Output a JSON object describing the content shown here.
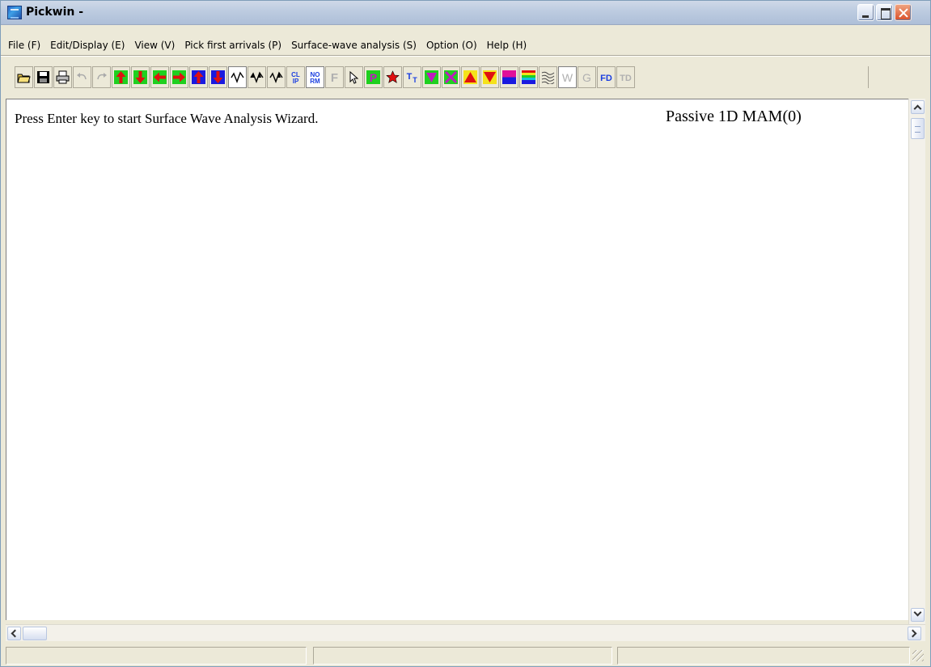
{
  "window": {
    "title": "Pickwin -"
  },
  "menu": [
    "File (F)",
    "Edit/Display (E)",
    "View (V)",
    "Pick first arrivals (P)",
    "Surface-wave analysis (S)",
    "Option (O)",
    "Help (H)"
  ],
  "toolbar": {
    "buttons": [
      {
        "icon": "open-folder-icon"
      },
      {
        "icon": "save-icon"
      },
      {
        "icon": "print-icon"
      },
      {
        "icon": "undo-icon"
      },
      {
        "icon": "redo-icon"
      },
      {
        "icon": "arrow-up-icon"
      },
      {
        "icon": "arrow-down-icon"
      },
      {
        "icon": "arrow-left-icon"
      },
      {
        "icon": "arrow-right-icon"
      },
      {
        "icon": "blue-arrow-up-icon"
      },
      {
        "icon": "blue-arrow-down-icon"
      },
      {
        "icon": "waveform-icon"
      },
      {
        "icon": "waveform-filled-icon"
      },
      {
        "icon": "waveform-variable-icon"
      },
      {
        "icon": "clip-icon",
        "text": "CL IP"
      },
      {
        "icon": "normalize-icon",
        "text": "NO RM"
      },
      {
        "icon": "f-icon",
        "text": "F"
      },
      {
        "icon": "pointer-icon"
      },
      {
        "icon": "pick-p-icon",
        "text": "P"
      },
      {
        "icon": "star-icon"
      },
      {
        "icon": "tt-icon",
        "text": "TT"
      },
      {
        "icon": "green-check-icon"
      },
      {
        "icon": "green-x-icon"
      },
      {
        "icon": "red-triangle-up-icon"
      },
      {
        "icon": "red-triangle-down-icon"
      },
      {
        "icon": "color-bar-icon"
      },
      {
        "icon": "rainbow-bar-icon"
      },
      {
        "icon": "wiggle-image-icon"
      },
      {
        "icon": "w-icon",
        "text": "W"
      },
      {
        "icon": "g-icon",
        "text": "G"
      },
      {
        "icon": "fd-icon",
        "text": "FD"
      },
      {
        "icon": "td-icon",
        "text": "TD"
      }
    ]
  },
  "content": {
    "prompt": "Press Enter key to start Surface Wave Analysis Wizard.",
    "mode": "Passive 1D MAM(0)"
  }
}
